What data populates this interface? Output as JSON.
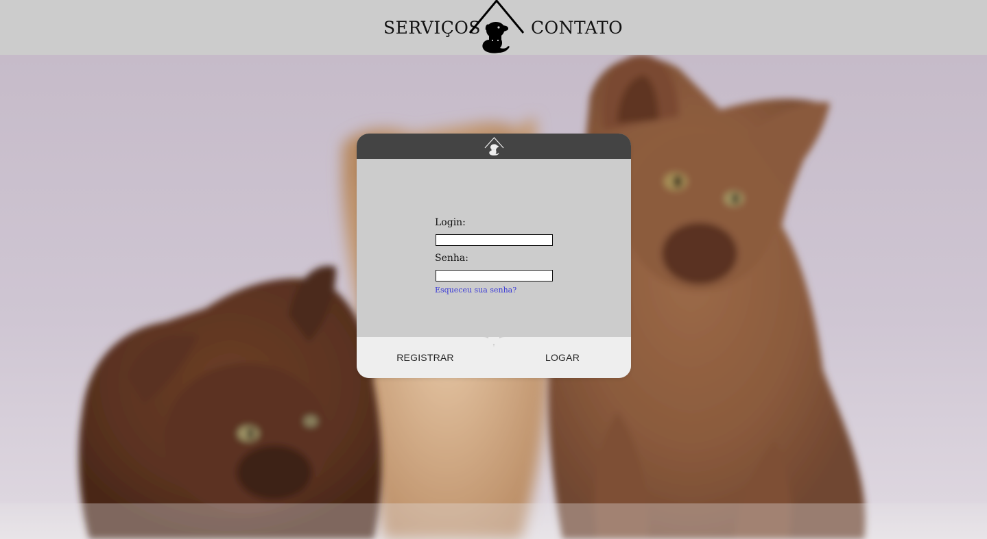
{
  "nav": {
    "services_label": "SERVIÇOS",
    "contact_label": "CONTATO",
    "logo_icon": "house-dog-cat-icon"
  },
  "login_form": {
    "login_label": "Login:",
    "login_value": "",
    "password_label": "Senha:",
    "password_value": "",
    "forgot_password_link": "Esqueceu sua senha?",
    "register_button": "REGISTRAR",
    "login_button": "LOGAR",
    "header_icon": "house-dog-cat-icon"
  },
  "background": {
    "image": "blurred-kittens-photo"
  },
  "colors": {
    "topbar": "#cccccc",
    "card_header": "#444444",
    "card_body": "#cccccc",
    "card_buttons": "#eeeeee",
    "link": "#3a3ad6"
  }
}
